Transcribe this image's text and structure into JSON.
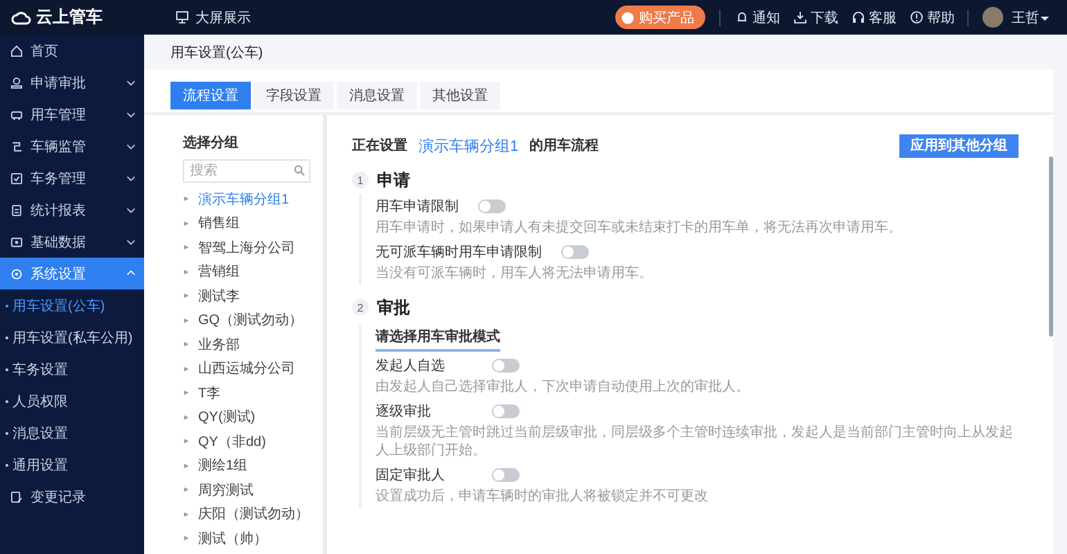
{
  "topbar": {
    "logo": "云上管车",
    "screen_link": "大屏展示",
    "buy_button": "购买产品",
    "actions": [
      "通知",
      "下载",
      "客服",
      "帮助"
    ],
    "user": "王哲"
  },
  "sidebar": {
    "items": [
      {
        "label": "首页",
        "selected": false
      },
      {
        "label": "申请审批",
        "selected": false,
        "expanded": false,
        "has_children": true
      },
      {
        "label": "用车管理",
        "selected": false,
        "expanded": false,
        "has_children": true
      },
      {
        "label": "车辆监管",
        "selected": false,
        "expanded": false,
        "has_children": true
      },
      {
        "label": "车务管理",
        "selected": false,
        "expanded": false,
        "has_children": true
      },
      {
        "label": "统计报表",
        "selected": false,
        "expanded": false,
        "has_children": true
      },
      {
        "label": "基础数据",
        "selected": false,
        "expanded": false,
        "has_children": true
      },
      {
        "label": "系统设置",
        "selected": true,
        "expanded": true,
        "has_children": true,
        "children": [
          {
            "label": "用车设置(公车)",
            "selected": true
          },
          {
            "label": "用车设置(私车公用)",
            "selected": false
          },
          {
            "label": "车务设置",
            "selected": false
          },
          {
            "label": "人员权限",
            "selected": false
          },
          {
            "label": "消息设置",
            "selected": false
          },
          {
            "label": "通用设置",
            "selected": false
          }
        ]
      },
      {
        "label": "变更记录",
        "selected": false
      }
    ]
  },
  "page_title": "用车设置(公车)",
  "tabs": [
    {
      "label": "流程设置",
      "selected": true
    },
    {
      "label": "字段设置",
      "selected": false
    },
    {
      "label": "消息设置",
      "selected": false
    },
    {
      "label": "其他设置",
      "selected": false
    }
  ],
  "groups": {
    "title": "选择分组",
    "search": {
      "placeholder": "搜索"
    },
    "items": [
      {
        "label": "演示车辆分组1",
        "selected": true
      },
      {
        "label": "销售组",
        "selected": false
      },
      {
        "label": "智驾上海分公司",
        "selected": false
      },
      {
        "label": "营销组",
        "selected": false
      },
      {
        "label": "测试李",
        "selected": false
      },
      {
        "label": "GQ（测试勿动）",
        "selected": false
      },
      {
        "label": "业务部",
        "selected": false
      },
      {
        "label": "山西运城分公司",
        "selected": false
      },
      {
        "label": "T李",
        "selected": false
      },
      {
        "label": "QY(测试)",
        "selected": false
      },
      {
        "label": "QY（非dd)",
        "selected": false
      },
      {
        "label": "测绘1组",
        "selected": false
      },
      {
        "label": "周穷测试",
        "selected": false
      },
      {
        "label": "庆阳（测试勿动）",
        "selected": false
      },
      {
        "label": "测试（帅）",
        "selected": false
      }
    ]
  },
  "flow": {
    "prefix": "正在设置",
    "group": "演示车辆分组1",
    "suffix": "的用车流程",
    "apply_button": "应用到其他分组",
    "sections": [
      {
        "number": "1",
        "title": "申请",
        "settings": [
          {
            "label": "用车申请限制",
            "on": false,
            "description": "用车申请时，如果申请人有未提交回车或未结束打卡的用车单，将无法再次申请用车。"
          },
          {
            "label": "无可派车辆时用车申请限制",
            "on": false,
            "description": "当没有可派车辆时，用车人将无法申请用车。"
          }
        ]
      },
      {
        "number": "2",
        "title": "审批",
        "subtitle": "请选择用车审批模式",
        "settings": [
          {
            "label": "发起人自选",
            "on": false,
            "description": "由发起人自己选择审批人，下次申请自动使用上次的审批人。"
          },
          {
            "label": "逐级审批",
            "on": false,
            "description": "当前层级无主管时跳过当前层级审批，同层级多个主管时连续审批，发起人是当前部门主管时向上从发起人上级部门开始。"
          },
          {
            "label": "固定审批人",
            "on": false,
            "description": "设置成功后，申请车辆时的审批人将被锁定并不可更改"
          }
        ]
      }
    ]
  }
}
